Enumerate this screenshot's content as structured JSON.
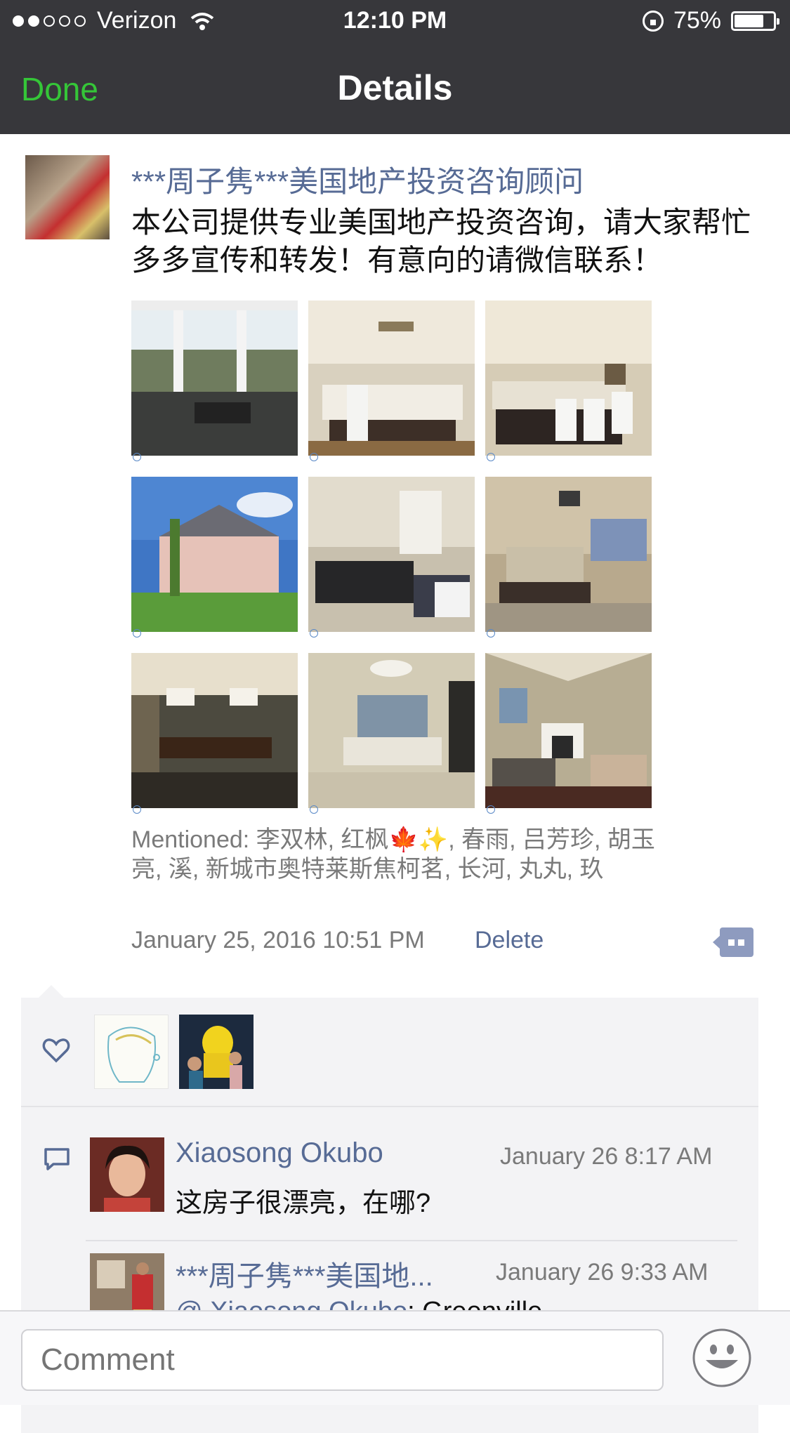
{
  "status_bar": {
    "carrier": "Verizon",
    "time": "12:10 PM",
    "battery": "75%",
    "battery_level": 0.75
  },
  "nav": {
    "done_label": "Done",
    "title": "Details"
  },
  "post": {
    "author": "***周子隽***美国地产投资咨询顾问",
    "text": "本公司提供专业美国地产投资咨询，请大家帮忙多多宣传和转发！有意向的请微信联系！",
    "photos": [
      "porch-view-photo",
      "kitchen-photo-1",
      "kitchen-photo-2",
      "house-exterior-photo",
      "living-room-photo",
      "bedroom-photo",
      "dining-room-photo",
      "bathroom-photo",
      "family-room-photo"
    ],
    "mentioned": "Mentioned: 李双林, 红枫🍁✨, 春雨, 吕芳珍, 胡玉亮, 溪, 新城市奥特莱斯焦柯茗, 长河, 丸丸, 玖",
    "date": "January 25, 2016 10:51 PM",
    "delete_label": "Delete"
  },
  "comments": [
    {
      "name": "Xiaosong Okubo",
      "time": "January 26 8:17 AM",
      "text": "这房子很漂亮，在哪?"
    },
    {
      "name": "***周子隽***美国地...",
      "time": "January 26 9:33 AM",
      "text": "@ Xiaosong Okubo: Greenville"
    }
  ],
  "comment_bar": {
    "placeholder": "Comment"
  },
  "colors": {
    "nav_bg": "#37373b",
    "done_green": "#35c638",
    "link_blue": "#576b95",
    "panel_bg": "#f3f3f5"
  }
}
